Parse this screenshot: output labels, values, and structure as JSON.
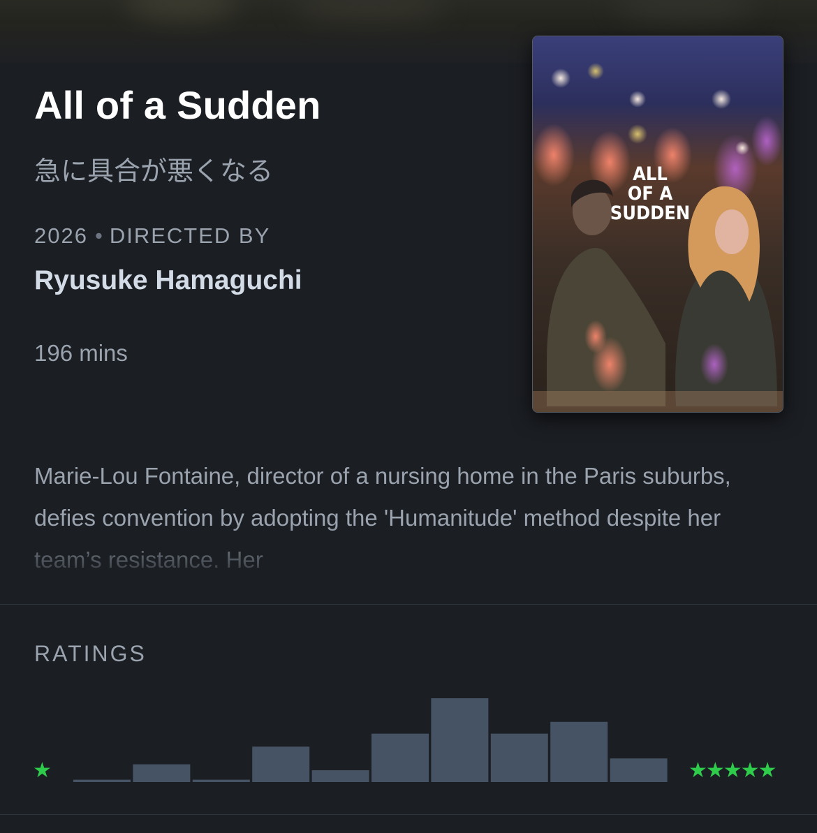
{
  "film": {
    "title": "All of a Sudden",
    "original_title": "急に具合が悪くなる",
    "year": "2026",
    "directed_by_label": "DIRECTED BY",
    "separator": "•",
    "director": "Ryusuke Hamaguchi",
    "runtime": "196 mins",
    "synopsis": "Marie-Lou Fontaine, director of a nursing home in the Paris suburbs, defies convention by adopting the 'Humanitude' method despite her team’s resistance. Her"
  },
  "poster": {
    "title_lines": [
      "ALL",
      "OF A",
      "SUDDEN"
    ],
    "icon": "poster-image"
  },
  "ratings": {
    "label": "RATINGS",
    "min_star": "★",
    "max_stars": "★★★★★",
    "star_color": "#2ecc4a",
    "bar_color": "#465364",
    "chart_data": {
      "type": "bar",
      "categories": [
        "0.5",
        "1",
        "1.5",
        "2",
        "2.5",
        "3",
        "3.5",
        "4",
        "4.5",
        "5"
      ],
      "values": [
        2,
        15,
        2,
        30,
        10,
        41,
        71,
        41,
        51,
        20
      ],
      "ylim": [
        0,
        71
      ]
    }
  },
  "colors": {
    "background": "#1b1e23",
    "divider": "#2f353d",
    "text_primary": "#ffffff",
    "text_secondary": "#9aa3ae",
    "text_director": "#d3dbe6"
  }
}
